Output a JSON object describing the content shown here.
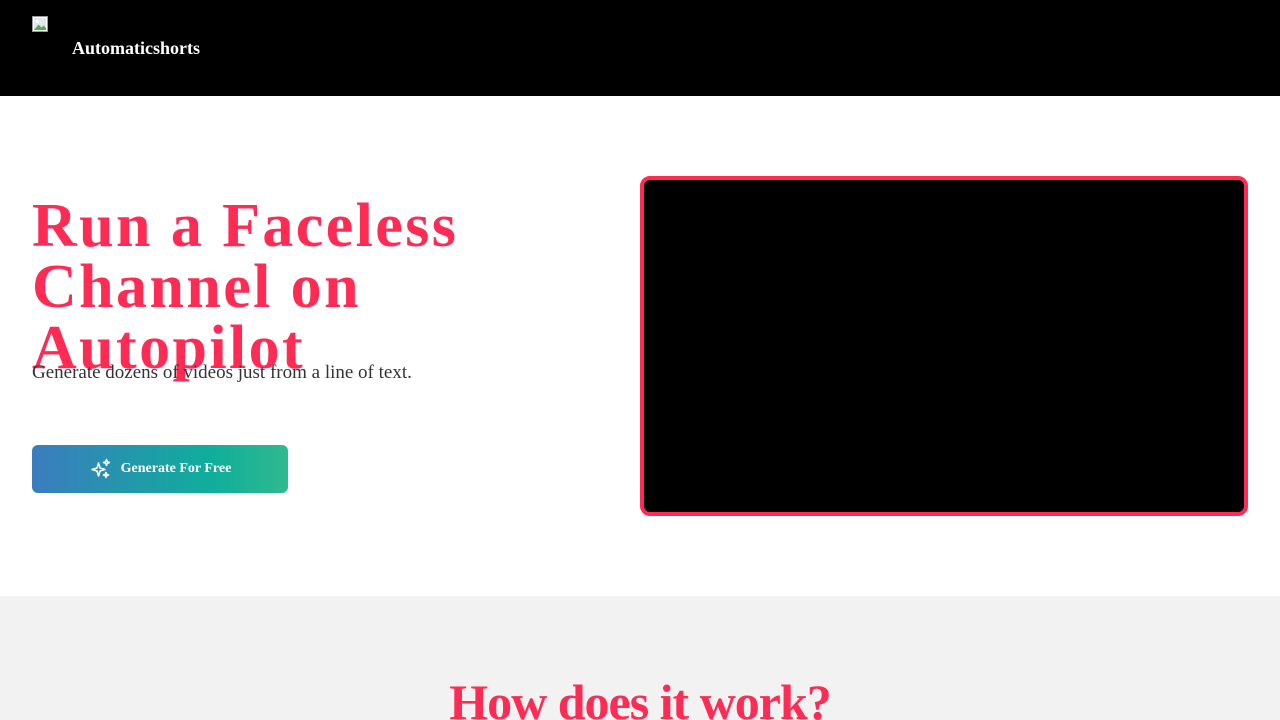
{
  "header": {
    "brand": "Automaticshorts",
    "logo_icon": "broken-image-icon"
  },
  "hero": {
    "title": "Run a Faceless Channel on Autopilot",
    "subtitle": "Generate dozens of videos just from a line of text.",
    "cta_label": "Generate For Free",
    "cta_icon": "sparkles-icon"
  },
  "how_it_works": {
    "title": "How does it work?"
  },
  "colors": {
    "accent": "#fe2c55",
    "header_bg": "#000000",
    "section_bg": "#f2f2f2",
    "cta_gradient_start": "#3b7cbf",
    "cta_gradient_end": "#2fb98f"
  }
}
